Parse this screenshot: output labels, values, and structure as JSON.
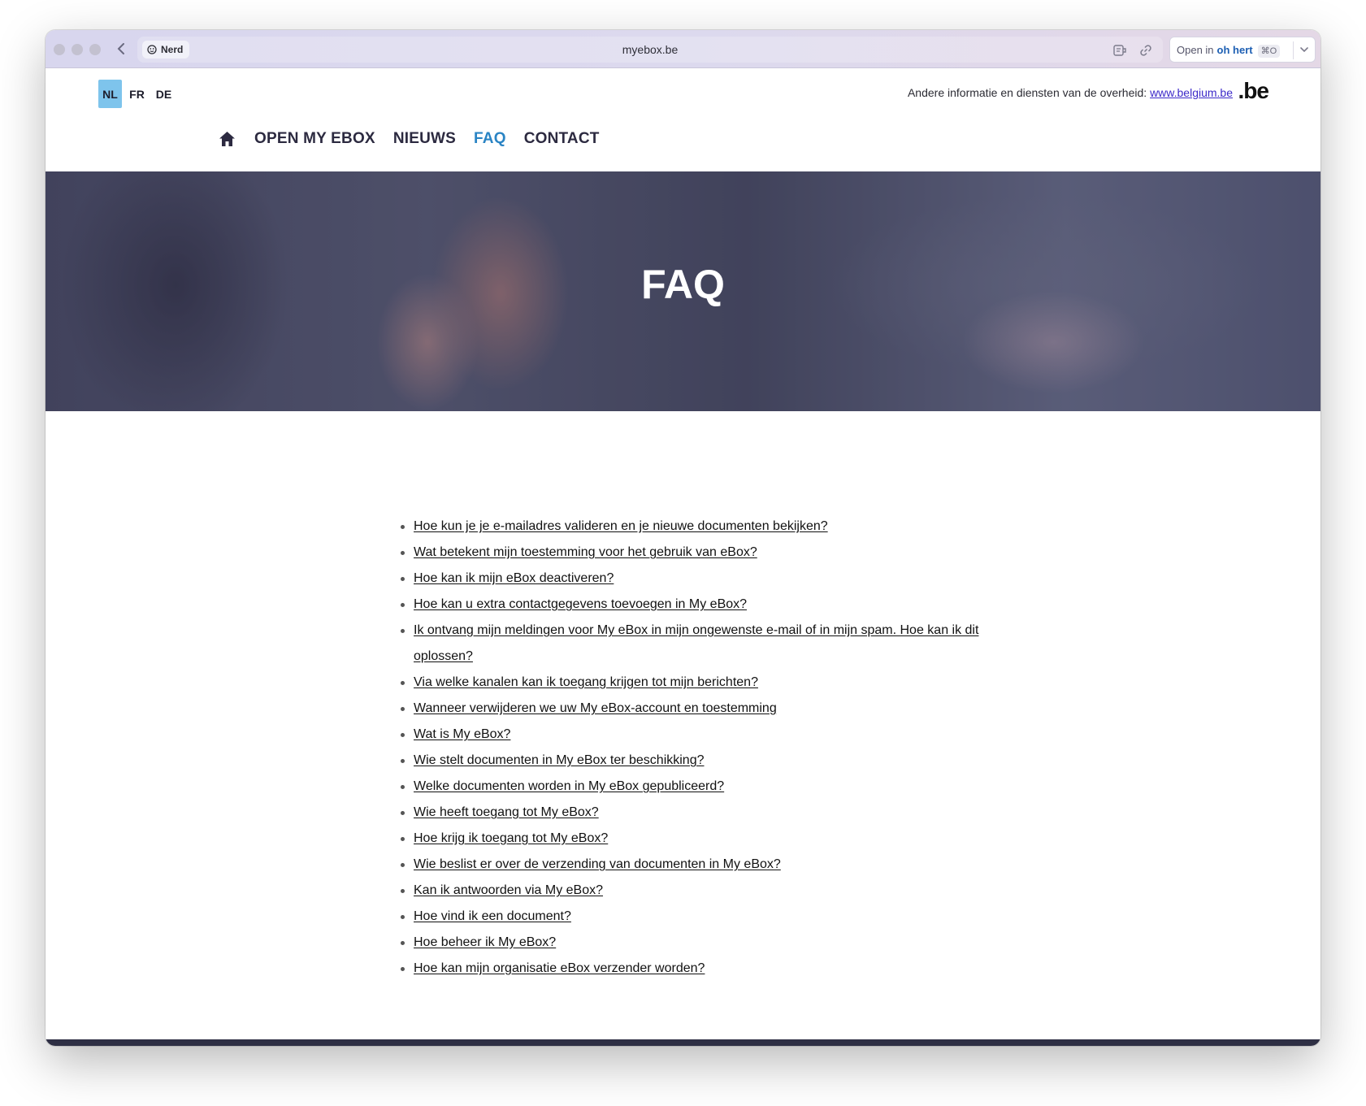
{
  "browser": {
    "profile_label": "Nerd",
    "url": "myebox.be",
    "open_in_prefix": "Open in",
    "open_in_app": "oh hert",
    "open_in_shortcut": "⌘O"
  },
  "header": {
    "languages": [
      {
        "code": "NL",
        "active": true
      },
      {
        "code": "FR",
        "active": false
      },
      {
        "code": "DE",
        "active": false
      }
    ],
    "gov_info_text": "Andere informatie en diensten van de overheid:",
    "gov_info_link": "www.belgium.be",
    "logo_text": ".be"
  },
  "nav": {
    "items": [
      {
        "label": "OPEN MY EBOX",
        "active": false
      },
      {
        "label": "NIEUWS",
        "active": false
      },
      {
        "label": "FAQ",
        "active": true
      },
      {
        "label": "CONTACT",
        "active": false
      }
    ]
  },
  "hero": {
    "title": "FAQ"
  },
  "faq": {
    "questions": [
      "Hoe kun je je e-mailadres valideren en je nieuwe documenten bekijken?",
      "Wat betekent mijn toestemming voor het gebruik van eBox?",
      "Hoe kan ik mijn eBox deactiveren?",
      "Hoe kan u extra contactgegevens toevoegen in My eBox?",
      "Ik ontvang mijn meldingen voor My eBox in mijn ongewenste e-mail of in mijn spam. Hoe kan ik dit oplossen?",
      "Via welke kanalen kan ik toegang krijgen tot mijn berichten?",
      "Wanneer verwijderen we uw My eBox-account en toestemming",
      "Wat is My eBox?",
      "Wie stelt documenten in My eBox ter beschikking?",
      "Welke documenten worden in My eBox gepubliceerd?",
      "Wie heeft toegang tot My eBox?",
      "Hoe krijg ik toegang tot My eBox?",
      "Wie beslist er over de verzending van documenten in My eBox?",
      "Kan ik antwoorden via My eBox?",
      "Hoe vind ik een document?",
      "Hoe beheer ik My eBox?",
      "Hoe kan mijn organisatie eBox verzender worden?"
    ]
  },
  "colors": {
    "active_language_bg": "#7ec4ec",
    "active_nav": "#2a84c4",
    "nav_text": "#2c2a40",
    "link_belgium": "#3d2ac9",
    "footer": "#2e2f44"
  }
}
